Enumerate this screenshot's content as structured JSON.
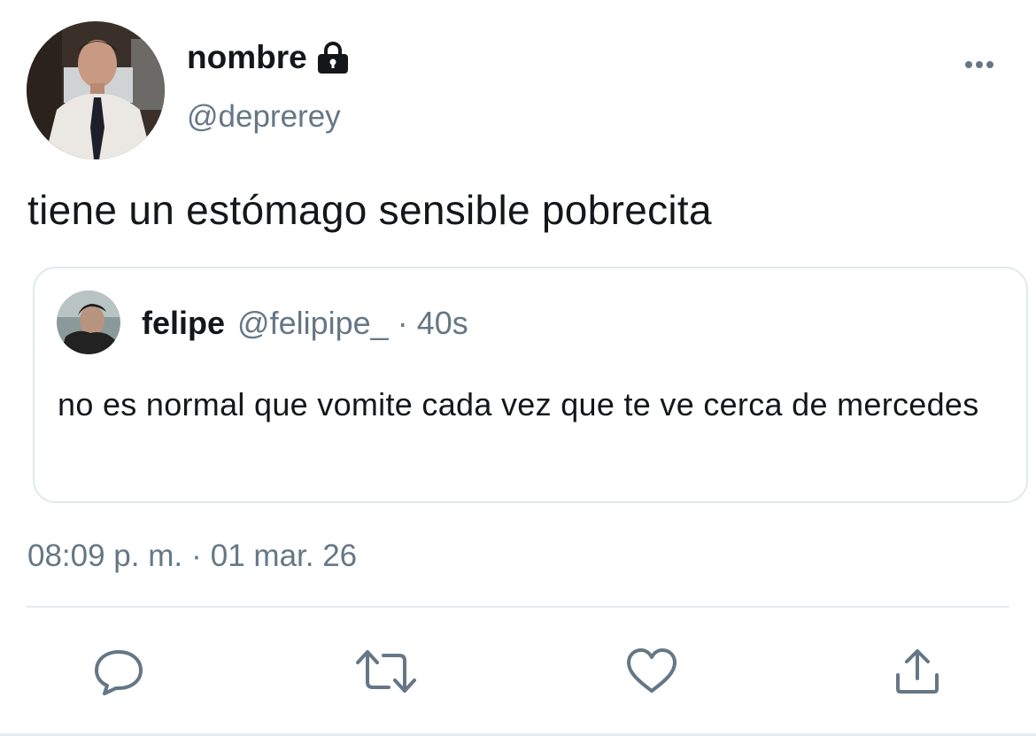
{
  "tweet": {
    "author": {
      "display_name": "nombre",
      "handle": "@deprerey",
      "avatar_icon": "profile-photo",
      "protected_icon": "lock-icon"
    },
    "more_icon": "more-horizontal-icon",
    "text": "tiene un estómago sensible pobrecita",
    "quoted": {
      "display_name": "felipe",
      "handle": "@felipipe_",
      "separator": "·",
      "time": "40s",
      "text": "no es normal que vomite cada vez que te ve cerca de mercedes",
      "avatar_icon": "profile-photo"
    },
    "timestamp": {
      "time": "08:09 p. m.",
      "separator": "·",
      "date": "01 mar. 26"
    },
    "actions": [
      {
        "name": "reply",
        "icon": "reply-icon"
      },
      {
        "name": "retweet",
        "icon": "retweet-icon"
      },
      {
        "name": "like",
        "icon": "heart-icon"
      },
      {
        "name": "share",
        "icon": "share-icon"
      }
    ]
  },
  "colors": {
    "text": "#14171a",
    "secondary": "#657786",
    "border": "#e1e8ed",
    "icon": "#657786"
  }
}
